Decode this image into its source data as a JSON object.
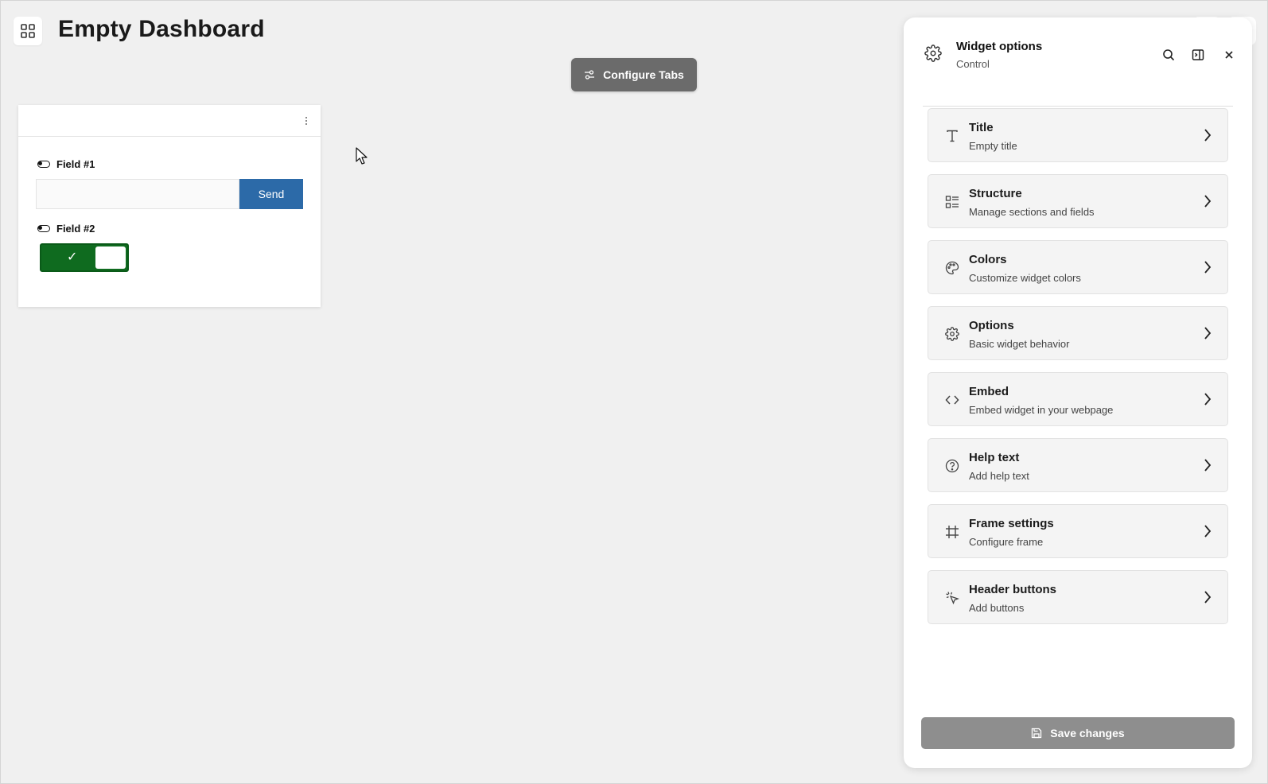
{
  "page": {
    "title": "Empty Dashboard",
    "configure_tabs_label": "Configure Tabs"
  },
  "widget": {
    "field1_label": "Field #1",
    "field1_value": "",
    "send_label": "Send",
    "field2_label": "Field #2",
    "field2_state": true,
    "switch_check": "✓"
  },
  "panel": {
    "title": "Widget options",
    "subtitle": "Control",
    "items": [
      {
        "label": "Title",
        "desc": "Empty title",
        "icon": "type-icon"
      },
      {
        "label": "Structure",
        "desc": "Manage sections and fields",
        "icon": "structure-icon"
      },
      {
        "label": "Colors",
        "desc": "Customize widget colors",
        "icon": "palette-icon"
      },
      {
        "label": "Options",
        "desc": "Basic widget behavior",
        "icon": "gear-icon"
      },
      {
        "label": "Embed",
        "desc": "Embed widget in your webpage",
        "icon": "code-icon"
      },
      {
        "label": "Help text",
        "desc": "Add help text",
        "icon": "help-circle-icon"
      },
      {
        "label": "Frame settings",
        "desc": "Configure frame",
        "icon": "frame-icon"
      },
      {
        "label": "Header buttons",
        "desc": "Add buttons",
        "icon": "pointer-click-icon"
      }
    ],
    "save_label": "Save changes"
  },
  "colors": {
    "send": "#2c6aa8",
    "switch_on": "#0f6b1f",
    "configure_tabs_bg": "#6b6b6b",
    "save_disabled": "#8e8e8e"
  }
}
